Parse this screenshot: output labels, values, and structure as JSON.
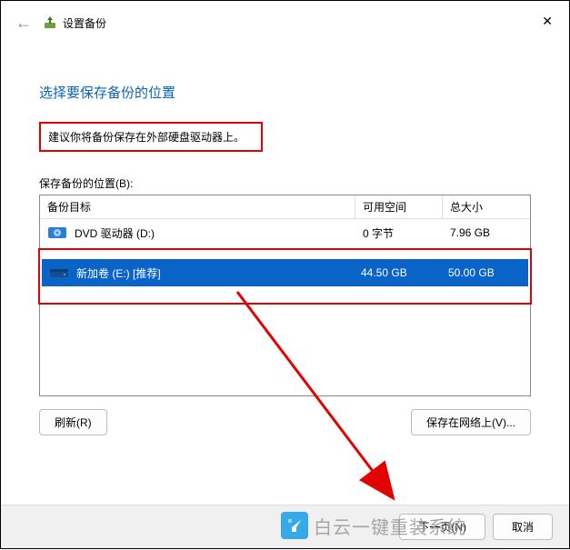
{
  "titlebar": {
    "title": "设置备份"
  },
  "heading": "选择要保存备份的位置",
  "recommend": "建议你将备份保存在外部硬盘驱动器上。",
  "list_label": "保存备份的位置(B):",
  "columns": {
    "target": "备份目标",
    "free": "可用空间",
    "total": "总大小"
  },
  "drives": [
    {
      "icon": "dvd",
      "name": "DVD 驱动器 (D:)",
      "free": "0 字节",
      "total": "7.96 GB",
      "selected": false
    },
    {
      "icon": "hdd",
      "name": "新加卷 (E:) [推荐]",
      "free": "44.50 GB",
      "total": "50.00 GB",
      "selected": true
    }
  ],
  "buttons": {
    "refresh": "刷新(R)",
    "network": "保存在网络上(V)...",
    "next": "下一页(N)",
    "cancel": "取消"
  },
  "watermark": "白云一键重装系统"
}
